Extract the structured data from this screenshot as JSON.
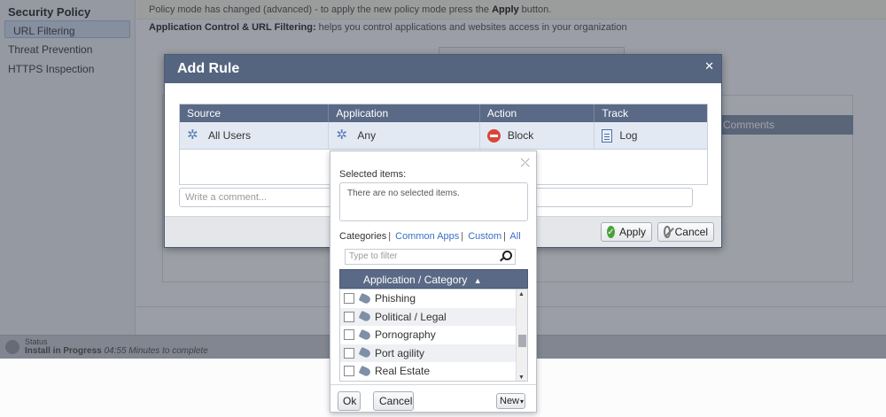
{
  "sidebar": {
    "title": "Security Policy",
    "items": [
      {
        "label": "URL Filtering",
        "active": true
      },
      {
        "label": "Threat Prevention",
        "active": false
      },
      {
        "label": "HTTPS Inspection",
        "active": false
      }
    ]
  },
  "notice": {
    "text_before": "Policy mode has changed (advanced) - to apply the new policy mode press the ",
    "bold": "Apply",
    "text_after": " button."
  },
  "description": {
    "bold": "Application Control & URL Filtering:",
    "text": " helps you control applications and websites access in your organization"
  },
  "background": {
    "comments_header": "Comments"
  },
  "status": {
    "label": "Status",
    "message": "Install in Progress",
    "detail": "04:55 Minutes to complete"
  },
  "dialog": {
    "title": "Add Rule",
    "close_icon": "close-icon",
    "columns": [
      "Source",
      "Application",
      "Action",
      "Track"
    ],
    "row": {
      "source": "All Users",
      "application": "Any",
      "action": "Block",
      "track": "Log"
    },
    "comment_placeholder": "Write a comment...",
    "apply_label": "Apply",
    "cancel_label": "Cancel"
  },
  "picker": {
    "selected_label": "Selected items:",
    "empty_text": "There are no selected items.",
    "categories_label": "Categories",
    "category_links": [
      "Common Apps",
      "Custom",
      "All"
    ],
    "filter_placeholder": "Type to filter",
    "list_header": "Application / Category",
    "sort_indicator": "▲",
    "items": [
      "Phishing",
      "Political / Legal",
      "Pornography",
      "Port agility",
      "Real Estate"
    ],
    "ok_label": "Ok",
    "cancel_label": "Cancel",
    "new_label": "New",
    "new_arrow": "▾"
  },
  "colors": {
    "dialog_header": "#56657f",
    "table_header": "#5a6985",
    "block_red": "#d9453a",
    "apply_green": "#4aa33a",
    "link_blue": "#3a6fc4"
  }
}
